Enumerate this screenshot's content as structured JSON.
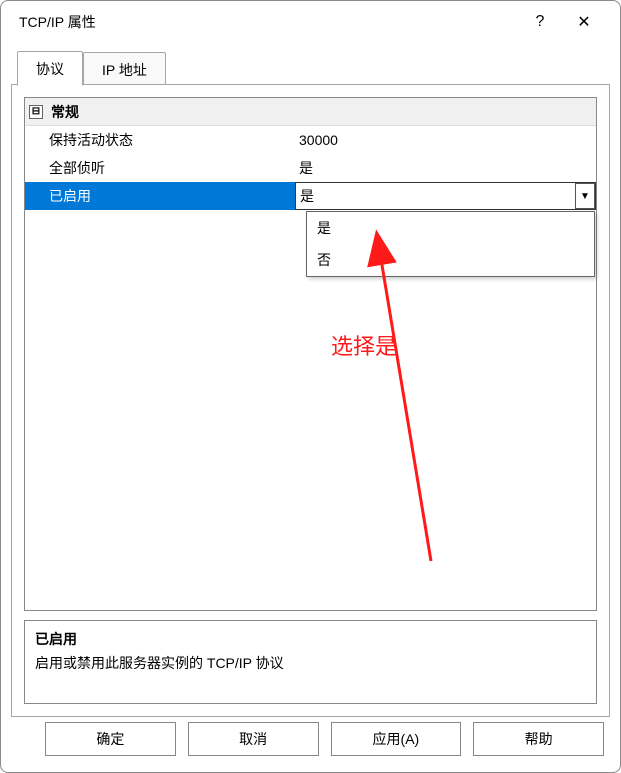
{
  "window": {
    "title": "TCP/IP 属性",
    "help_glyph": "?",
    "close_glyph": "✕"
  },
  "tabs": {
    "protocol": "协议",
    "ip": "IP 地址"
  },
  "grid": {
    "section": "常规",
    "collapse_glyph": "⊟",
    "rows": [
      {
        "label": "保持活动状态",
        "value": "30000"
      },
      {
        "label": "全部侦听",
        "value": "是"
      },
      {
        "label": "已启用",
        "value": "是"
      }
    ],
    "dropdown_glyph": "▼",
    "dropdown_options": [
      "是",
      "否"
    ]
  },
  "description": {
    "title": "已启用",
    "body": "启用或禁用此服务器实例的 TCP/IP 协议"
  },
  "buttons": {
    "ok": "确定",
    "cancel": "取消",
    "apply": "应用(A)",
    "help": "帮助"
  },
  "annotation": {
    "text": "选择是"
  }
}
